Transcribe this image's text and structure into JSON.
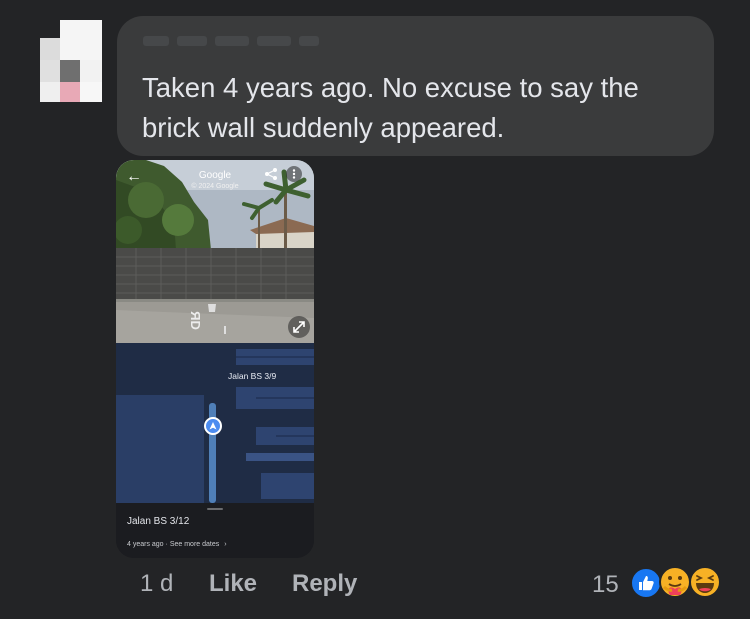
{
  "comment": {
    "text": "Taken 4 years ago. No excuse to say the brick wall suddenly appeared."
  },
  "attachment": {
    "header_title": "Google",
    "header_copyright": "© 2024 Google",
    "road_marking": "ЯD",
    "map_street_label": "Jalan BS 3/9",
    "location_name": "Jalan BS 3/12",
    "age_text": "4 years ago",
    "separator": " · ",
    "see_more": "See more dates",
    "see_more_chevron": "›"
  },
  "actions": {
    "time": "1 d",
    "like": "Like",
    "reply": "Reply"
  },
  "reactions": {
    "count": "15",
    "icons": [
      "like-icon",
      "care-icon",
      "haha-icon"
    ]
  },
  "colors": {
    "background": "#232426",
    "bubble": "#3a3b3c",
    "text": "#e4e6eb",
    "secondary": "#b0b3b8",
    "like_blue": "#1877f2"
  }
}
